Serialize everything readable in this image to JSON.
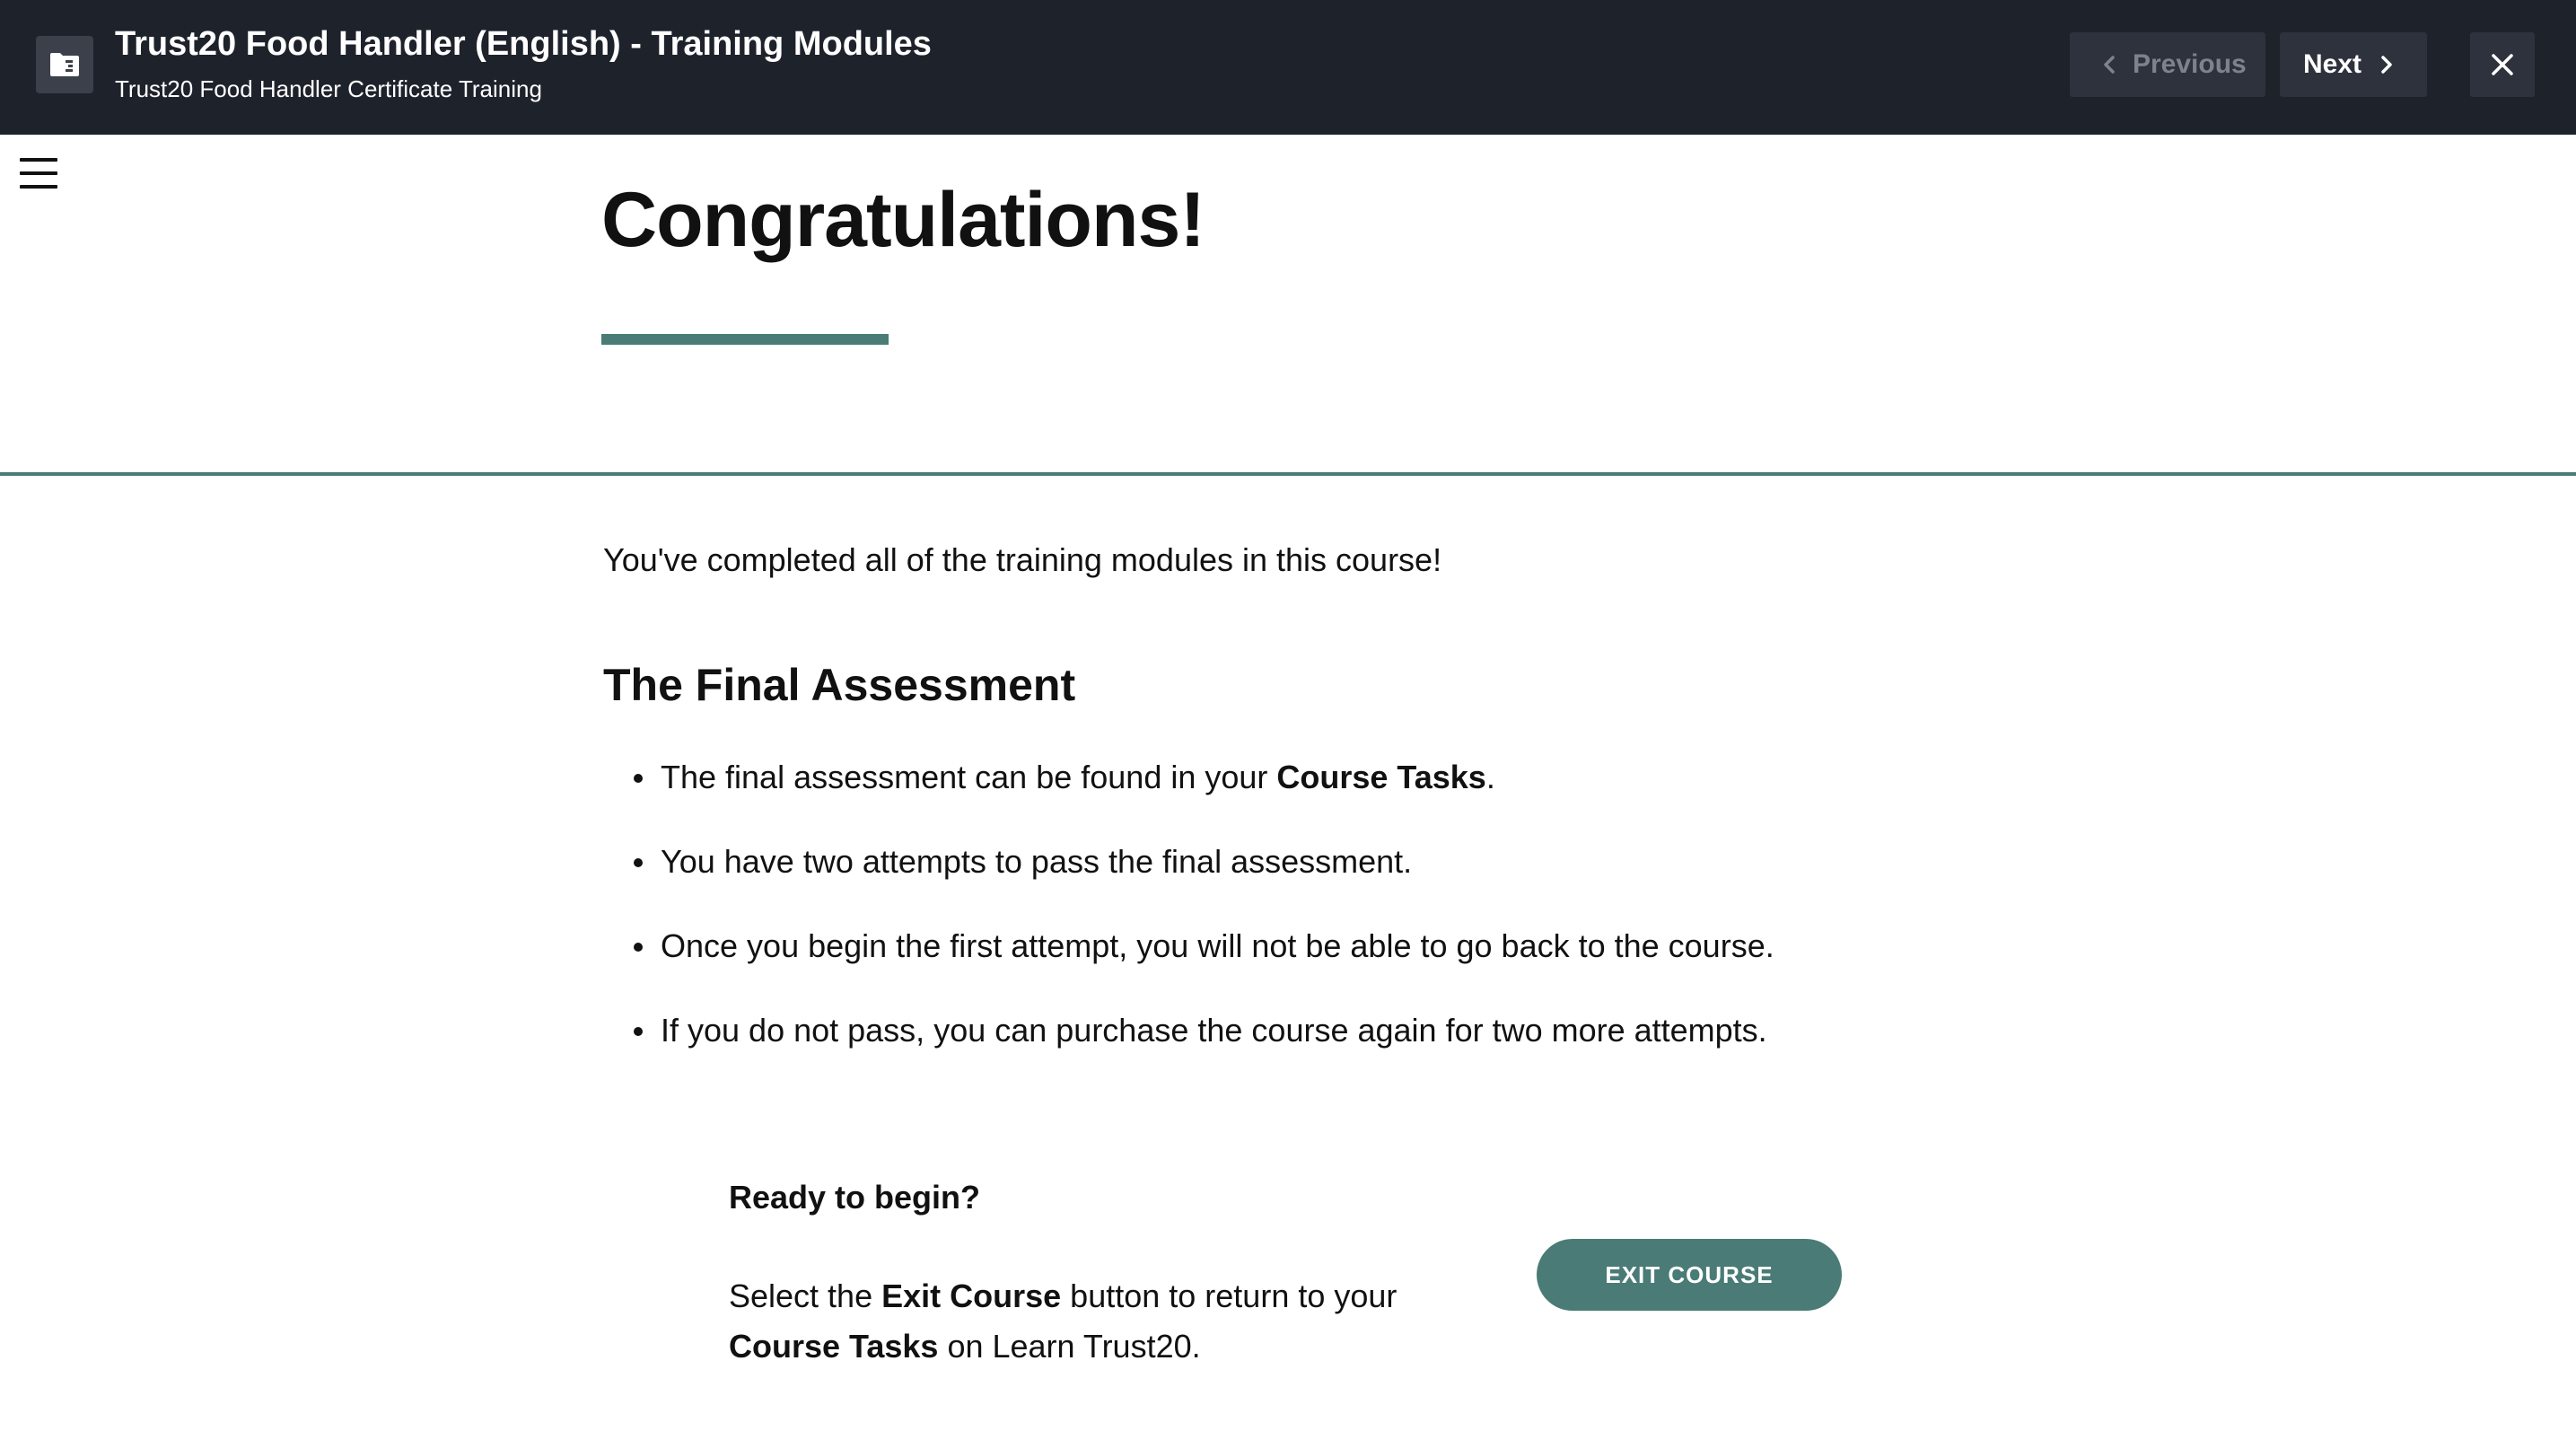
{
  "header": {
    "icon": "course-folder-icon",
    "title": "Trust20 Food Handler (English) - Training Modules",
    "subtitle": "Trust20 Food Handler Certificate Training",
    "previous_label": "Previous",
    "next_label": "Next",
    "close_icon": "close-icon",
    "background_color": "#1e222b"
  },
  "sidebar": {
    "menu_icon": "hamburger-menu-icon"
  },
  "main": {
    "title": "Congratulations!",
    "accent_color": "#4a7b76",
    "intro": "You've completed all of the training modules in this course!",
    "section_heading": "The Final Assessment",
    "bullets": [
      {
        "text_before": "The final assessment can be found in your ",
        "bold": "Course Tasks",
        "text_after": "."
      },
      {
        "text": "You have two attempts to pass the final assessment."
      },
      {
        "text": "Once you begin the first attempt, you will not be able to go back to the course."
      },
      {
        "text": "If you do not pass, you can purchase the course again for two more attempts."
      }
    ],
    "ready": {
      "heading": "Ready to begin?",
      "line1_before": "Select the ",
      "line1_bold": "Exit Course",
      "line1_after": " button to return to your",
      "line2_bold": "Course Tasks",
      "line2_after": " on Learn Trust20."
    },
    "exit_button_label": "EXIT COURSE"
  }
}
